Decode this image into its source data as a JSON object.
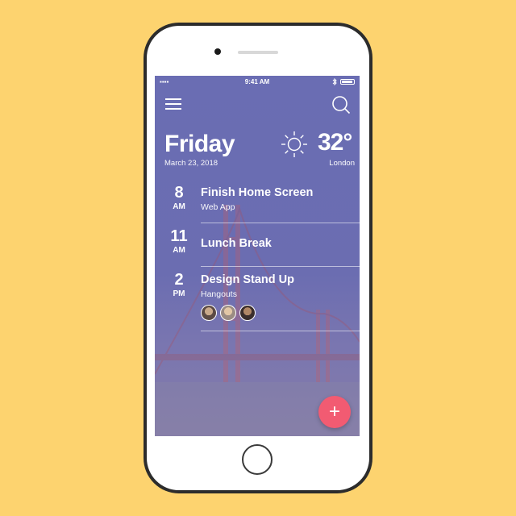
{
  "status_bar": {
    "time": "9:41 AM",
    "signal": "▪▪▪▪",
    "wifi": "wifi-icon",
    "bluetooth": "bluetooth-icon",
    "battery": "battery-icon"
  },
  "header": {
    "day": "Friday",
    "date": "March 23, 2018"
  },
  "weather": {
    "temperature": "32°",
    "city": "London",
    "icon": "sun-icon"
  },
  "events": [
    {
      "hour": "8",
      "ampm": "AM",
      "title": "Finish Home Screen",
      "subtitle": "Web App"
    },
    {
      "hour": "11",
      "ampm": "AM",
      "title": "Lunch Break",
      "subtitle": ""
    },
    {
      "hour": "2",
      "ampm": "PM",
      "title": "Design Stand Up",
      "subtitle": "Hangouts",
      "attendees": [
        "attendee-1",
        "attendee-2",
        "attendee-3"
      ]
    }
  ],
  "fab": {
    "label": "+"
  },
  "colors": {
    "background": "#fdd36f",
    "screen": "#6a6db3",
    "fab": "#f25b72"
  }
}
